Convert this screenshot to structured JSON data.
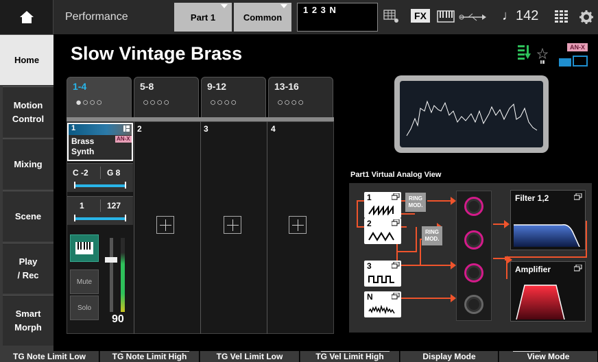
{
  "topbar": {
    "screen_label": "Performance",
    "part_select": "Part 1",
    "common_select": "Common",
    "part_number_display": "1 2 3 N",
    "fx_label": "FX",
    "tempo": "♩142"
  },
  "leftnav": {
    "items": [
      {
        "label": "Home",
        "active": true
      },
      {
        "label": "Motion\nControl"
      },
      {
        "label": "Mixing"
      },
      {
        "label": "Scene"
      },
      {
        "label": "Play\n/ Rec"
      },
      {
        "label": "Smart\nMorph"
      }
    ]
  },
  "performance_name": "Slow Vintage Brass",
  "brand_badge": "AN-X",
  "part_tabs": [
    {
      "label": "1-4",
      "dots": "●○○○",
      "active": true
    },
    {
      "label": "5-8",
      "dots": "○○○○"
    },
    {
      "label": "9-12",
      "dots": "○○○○"
    },
    {
      "label": "13-16",
      "dots": "○○○○"
    }
  ],
  "parts": {
    "part1": {
      "number": "1",
      "name": "Brass Synth",
      "engine_badge": "AN-X",
      "note_low": "C -2",
      "note_high": "G 8",
      "vel_low": "1",
      "vel_high": "127",
      "mute_label": "Mute",
      "solo_label": "Solo",
      "volume": "90"
    },
    "slot_numbers": [
      "2",
      "3",
      "4"
    ]
  },
  "virtual_analog": {
    "title": "Part1 Virtual Analog View",
    "oscillators": [
      "1",
      "2",
      "3",
      "N"
    ],
    "ring_mod_label": "RING MOD.",
    "filter_label": "Filter 1,2",
    "amp_label": "Amplifier"
  },
  "bottombar": {
    "buttons": [
      "TG Note Limit Low",
      "TG Note Limit High",
      "TG Vel Limit Low",
      "TG Vel Limit High",
      "Display Mode",
      "View Mode"
    ]
  },
  "colors": {
    "accent_blue": "#29b5e8",
    "accent_green": "#2ec05a",
    "knob_magenta": "#d31b8a",
    "route_orange": "#f0542c",
    "filter_blue": "#1f4fa8",
    "amp_red": "#d8202e"
  }
}
